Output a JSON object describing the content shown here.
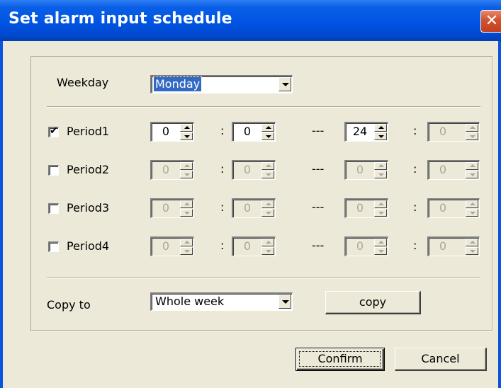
{
  "window": {
    "title": "Set alarm input schedule",
    "close_glyph": "✕"
  },
  "weekday": {
    "label": "Weekday",
    "value": "Monday"
  },
  "periods": [
    {
      "label": "Period1",
      "checked": true,
      "start_hour": "0",
      "start_min": "0",
      "end_hour": "24",
      "end_min": "0"
    },
    {
      "label": "Period2",
      "checked": false,
      "start_hour": "0",
      "start_min": "0",
      "end_hour": "0",
      "end_min": "0"
    },
    {
      "label": "Period3",
      "checked": false,
      "start_hour": "0",
      "start_min": "0",
      "end_hour": "0",
      "end_min": "0"
    },
    {
      "label": "Period4",
      "checked": false,
      "start_hour": "0",
      "start_min": "0",
      "end_hour": "0",
      "end_min": "0"
    }
  ],
  "separators": {
    "colon": ":",
    "dash": "---"
  },
  "check_glyph": "✔",
  "copy": {
    "label": "Copy to",
    "value": "Whole week",
    "button": "copy"
  },
  "footer": {
    "confirm": "Confirm",
    "cancel": "Cancel"
  }
}
